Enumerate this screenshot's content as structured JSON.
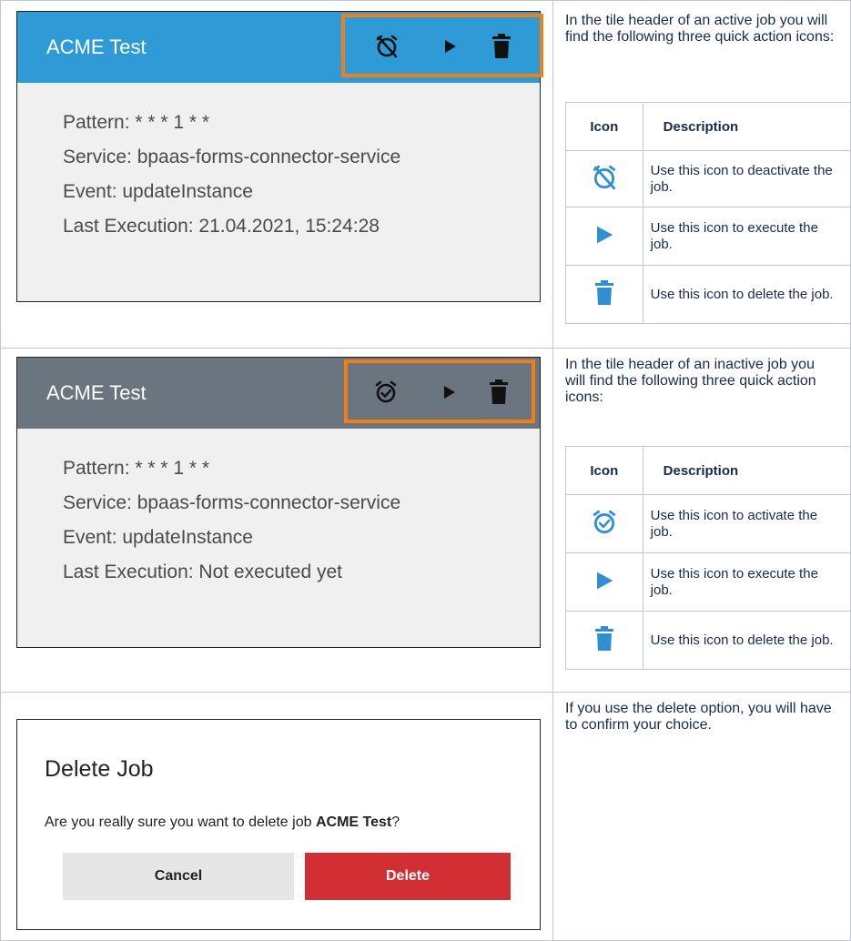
{
  "colors": {
    "active_header": "#2f9bd6",
    "inactive_header": "#6b7580",
    "highlight_border": "#f07f1a",
    "icon_blue": "#2f8fd0",
    "delete_red": "#d22f35"
  },
  "row1": {
    "tile": {
      "title": "ACME Test",
      "icons": [
        "alarm-off-icon",
        "play-icon",
        "trash-icon"
      ],
      "lines": [
        "Pattern: * * * 1 * *",
        "Service: bpaas-forms-connector-service",
        "Event: updateInstance",
        "Last Execution: 21.04.2021, 15:24:28"
      ]
    },
    "description": "In the tile header of an active job you will find the following three quick action icons:",
    "table": {
      "headers": [
        "Icon",
        "Description"
      ],
      "rows": [
        {
          "icon": "alarm-off-icon",
          "text": "Use this icon to deactivate the job."
        },
        {
          "icon": "play-icon",
          "text": "Use this icon to execute the job."
        },
        {
          "icon": "trash-icon",
          "text": "Use this icon to delete the job."
        }
      ]
    }
  },
  "row2": {
    "tile": {
      "title": "ACME Test",
      "icons": [
        "alarm-check-icon",
        "play-icon",
        "trash-icon"
      ],
      "lines": [
        "Pattern: * * * 1 * *",
        "Service: bpaas-forms-connector-service",
        "Event: updateInstance",
        "Last Execution: Not executed yet"
      ]
    },
    "description": "In the tile header of an inactive job you will find the following three quick action icons:",
    "table": {
      "headers": [
        "Icon",
        "Description"
      ],
      "rows": [
        {
          "icon": "alarm-check-icon",
          "text": "Use this icon to activate the job."
        },
        {
          "icon": "play-icon",
          "text": "Use this icon to execute the job."
        },
        {
          "icon": "trash-icon",
          "text": "Use this icon to delete the job."
        }
      ]
    }
  },
  "row3": {
    "dialog": {
      "title": "Delete Job",
      "text_prefix": "Are you really sure you want to delete job ",
      "job_name": "ACME Test",
      "text_suffix": "?",
      "cancel_label": "Cancel",
      "delete_label": "Delete"
    },
    "description": "If you use the delete option, you will have to confirm your choice."
  }
}
